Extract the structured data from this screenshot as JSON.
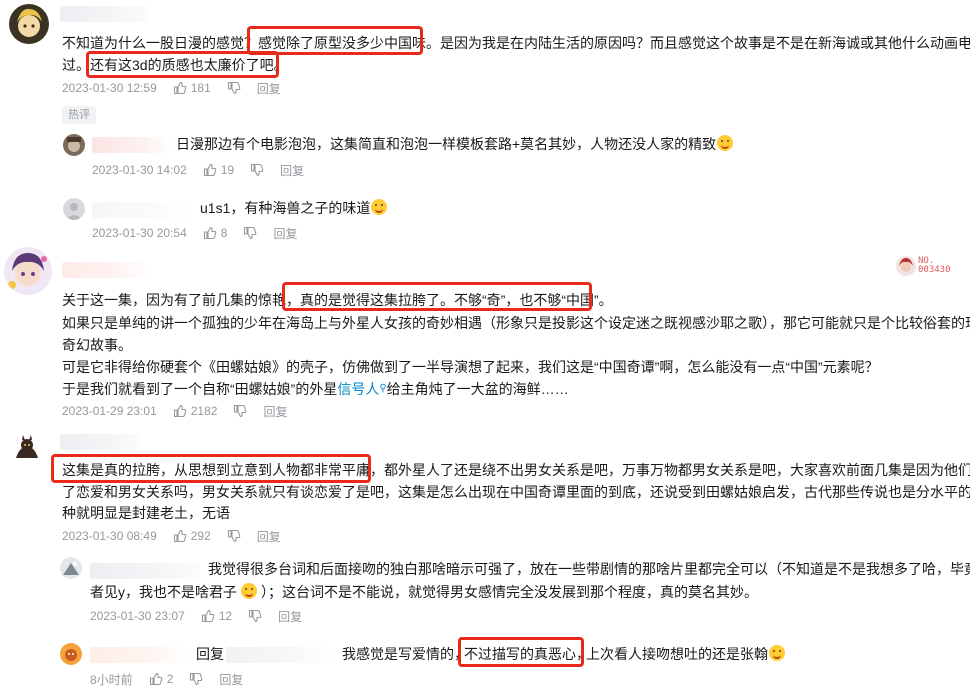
{
  "comments": [
    {
      "text_lines": [
        "不知道为什么一股日漫的感觉？感觉除了原型没多少中国味。是因为我是在内陆生活的原因吗？而且感觉这个故事是不是在新海诚或其他什么动画电影看",
        "过。还有这3d的质感也太廉价了吧。"
      ],
      "time": "2023-01-30 12:59",
      "likes": "181",
      "reply_label": "回复",
      "hot_label": "热评",
      "replies": [
        {
          "text": "日漫那边有个电影泡泡，这集简直和泡泡一样模板套路+莫名其妙，人物还没人家的精致",
          "time": "2023-01-30 14:02",
          "likes": "19",
          "reply_label": "回复"
        },
        {
          "text": "u1s1，有种海兽之子的味道",
          "time": "2023-01-30 20:54",
          "likes": "8",
          "reply_label": "回复"
        }
      ]
    },
    {
      "medal_no": "NO.",
      "medal_num": "003430",
      "text_lines": [
        "关于这一集，因为有了前几集的惊艳，真的是觉得这集拉胯了。不够“奇”，也不够“中国”。",
        "如果只是单纯的讲一个孤独的少年在海岛上与外星人女孩的奇妙相遇（形象只是投影这个设定迷之既视感沙耶之歌），那它可能就只是个比较俗套的现代",
        "奇幻故事。",
        "可是它非得给你硬套个《田螺姑娘》的壳子，仿佛做到了一半导演想了起来，我们这是“中国奇谭”啊，怎么能没有一点“中国”元素呢？",
        "于是我们就看到了一个自称“田螺姑娘”的外星",
        "给主角炖了一大盆的海鲜……"
      ],
      "link_text": "信号人",
      "time": "2023-01-29 23:01",
      "likes": "2182",
      "reply_label": "回复"
    },
    {
      "text_lines": [
        "这集是真的拉胯，从思想到立意到人物都非常平庸，都外星人了还是绕不出男女关系是吧，万事万物都男女关系是吧，大家喜欢前面几集是因为他们探讨",
        "了恋爱和男女关系吗，男女关系就只有谈恋爱了是吧，这集是怎么出现在中国奇谭里面的到底，还说受到田螺姑娘启发，古代那些传说也是分水平的，这",
        "种就明显是封建老土，无语"
      ],
      "time": "2023-01-30 08:49",
      "likes": "292",
      "reply_label": "回复",
      "replies": [
        {
          "text_lines": [
            "我觉得很多台词和后面接吻的独白那啥暗示可强了，放在一些带剧情的那啥片里都完全可以（不知道是不是我想多了哈，毕竟y",
            "者见y，我也不是啥君子",
            "）；这台词不是不能说，就觉得男女感情完全没发展到那个程度，真的莫名其妙。"
          ],
          "time": "2023-01-30 23:07",
          "likes": "12",
          "reply_label": "回复"
        },
        {
          "reply_prefix": "回复",
          "text_a": "我感觉是写爱情的，",
          "text_b": "不过描写的真恶心，",
          "text_c": "上次看人接吻想吐的还是张翰",
          "time": "8小时前",
          "likes": "2",
          "reply_label": "回复"
        }
      ]
    }
  ],
  "icons": [
    "like-icon",
    "dislike-icon",
    "more-icon"
  ],
  "colors": {
    "highlight_box": "#e8291c",
    "meta": "#9499a0",
    "link": "#008ac5"
  }
}
